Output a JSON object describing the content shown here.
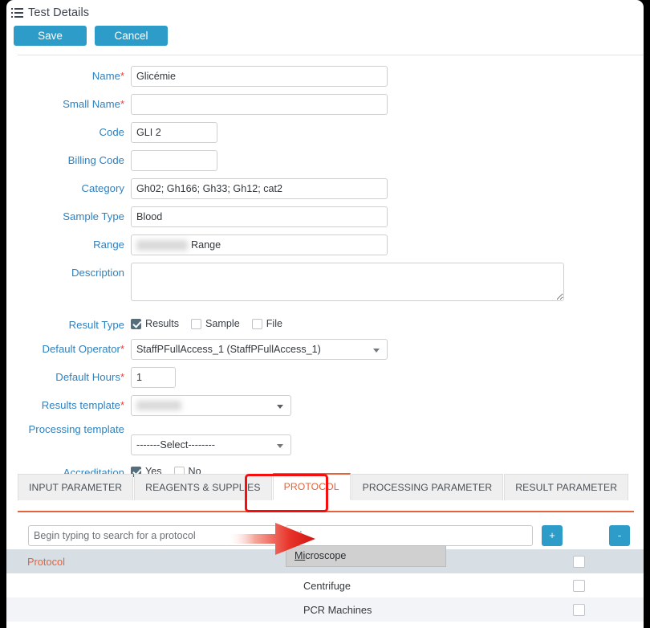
{
  "header": {
    "title": "Test Details",
    "icon": "list-icon"
  },
  "toolbar": {
    "save_label": "Save",
    "cancel_label": "Cancel"
  },
  "form": {
    "fields": [
      {
        "label": "Name",
        "required": true,
        "value": "Glicémie"
      },
      {
        "label": "Small Name",
        "required": true,
        "value": ""
      },
      {
        "label": "Code",
        "required": false,
        "value": "GLI 2"
      },
      {
        "label": "Billing Code",
        "required": false,
        "value": ""
      },
      {
        "label": "Category",
        "required": false,
        "value": "Gh02; Gh166; Gh33; Gh12; cat2"
      },
      {
        "label": "Sample Type",
        "required": false,
        "value": "Blood"
      },
      {
        "label": "Range",
        "required": false,
        "value": "Range"
      },
      {
        "label": "Description",
        "required": false,
        "value": ""
      },
      {
        "label": "Result Type",
        "required": false,
        "value": ""
      },
      {
        "label": "Default Operator",
        "required": true,
        "value": "StaffPFullAccess_1  (StaffPFullAccess_1)"
      },
      {
        "label": "Default Hours",
        "required": true,
        "value": "1"
      },
      {
        "label": "Results template",
        "required": true,
        "value": ""
      },
      {
        "label": "Processing template",
        "required": false,
        "value": "-------Select--------"
      },
      {
        "label": "Accreditation",
        "required": false,
        "value": ""
      }
    ],
    "result_type": {
      "options": [
        {
          "label": "Results",
          "checked": true
        },
        {
          "label": "Sample",
          "checked": false
        },
        {
          "label": "File",
          "checked": false
        }
      ]
    },
    "accreditation": {
      "options": [
        {
          "label": "Yes",
          "checked": true
        },
        {
          "label": "No",
          "checked": false
        }
      ]
    },
    "processing_template_selected": "-------Select--------",
    "results_template_selected": ""
  },
  "tabs": [
    {
      "label": "INPUT PARAMETER",
      "active": false
    },
    {
      "label": "REAGENTS & SUPPLIES",
      "active": false
    },
    {
      "label": "PROTOCOL",
      "active": true
    },
    {
      "label": "PROCESSING PARAMETER",
      "active": false
    },
    {
      "label": "RESULT PARAMETER",
      "active": false
    }
  ],
  "protocol_panel": {
    "search_placeholder": "Begin typing to search for a protocol",
    "search_value": "",
    "typed_value": "mi",
    "add_label": "+",
    "remove_label": "-",
    "autocomplete": {
      "items": [
        {
          "matched": "Mi",
          "rest": "croscope"
        }
      ]
    },
    "table": {
      "rows": [
        {
          "name": "Protocol",
          "value": "",
          "checked": false,
          "style": "head"
        },
        {
          "name": "",
          "value": "Centrifuge",
          "checked": false,
          "style": "odd"
        },
        {
          "name": "",
          "value": "PCR Machines",
          "checked": false,
          "style": "even"
        }
      ]
    }
  },
  "colors": {
    "button_blue": "#2e9cc8",
    "label_blue": "#2e81bf",
    "accent_orange": "#e4633a",
    "required_red": "#e8403a",
    "annotation_red": "#f60d0d",
    "checkbox_checked": "#546e7d",
    "table_head_bg": "#d7dee4"
  }
}
